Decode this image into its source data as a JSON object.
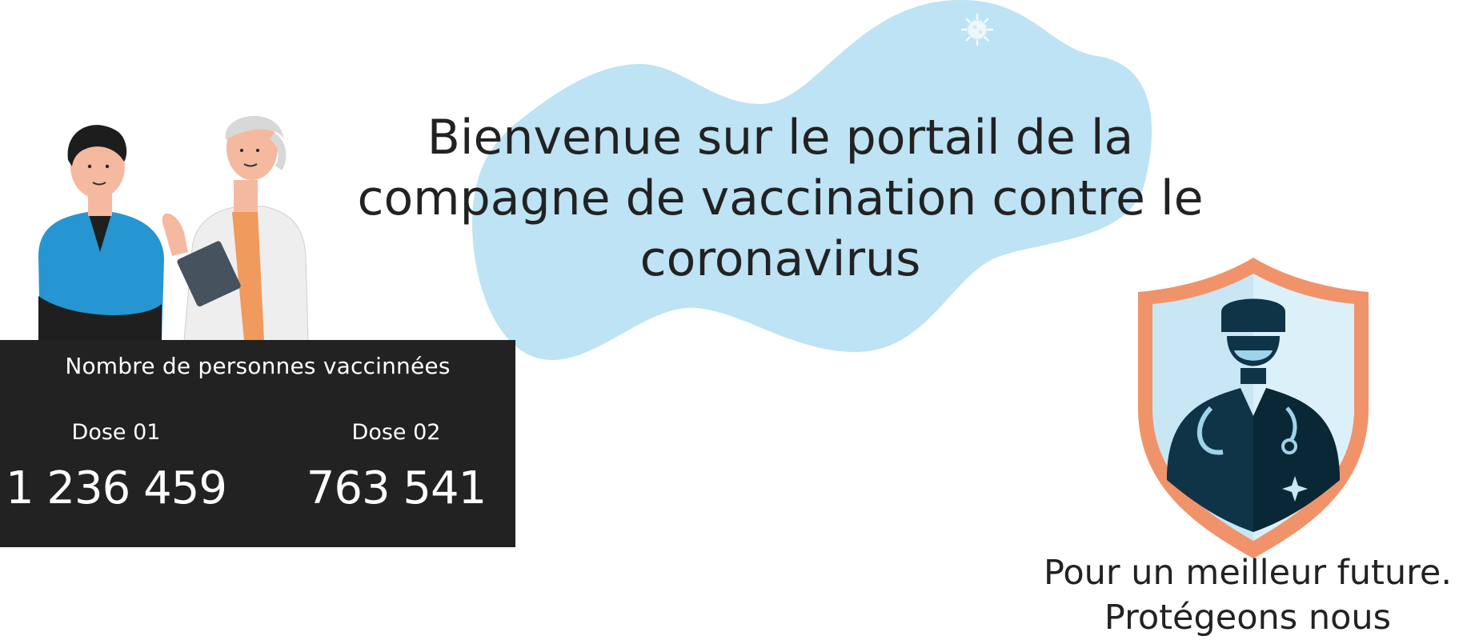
{
  "hero": {
    "title": "Bienvenue sur le portail de la compagne de vaccination contre le coronavirus"
  },
  "stats": {
    "heading": "Nombre de personnes vaccinnées",
    "doses": [
      {
        "label": "Dose 01",
        "value": "1 236 459"
      },
      {
        "label": "Dose 02",
        "value": "763 541"
      }
    ]
  },
  "tagline": {
    "line1": "Pour un meilleur future.",
    "line2": "Protégeons nous"
  },
  "colors": {
    "blob": "#bde3f4",
    "panel": "#222222",
    "shield_orange": "#f0936b",
    "shield_light": "#c9e6f5",
    "doctor_dark": "#0f3447",
    "text": "#222222"
  },
  "icons": {
    "virus": "virus-icon",
    "shield": "shield-doctor-icon",
    "people": "patient-and-doctor-illustration"
  }
}
